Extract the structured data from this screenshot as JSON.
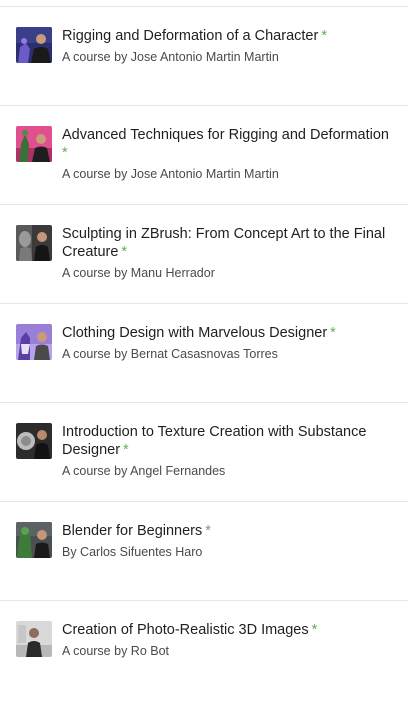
{
  "courses": [
    {
      "title": "Rigging and Deformation of a Character",
      "star": "*",
      "author": "A course by Jose Antonio Martin Martin",
      "thumbnail": "rigging-character-thumbnail"
    },
    {
      "title": "Advanced Techniques for Rigging and Deformation",
      "star": "*",
      "author": "A course by Jose Antonio Martin Martin",
      "thumbnail": "advanced-rigging-thumbnail"
    },
    {
      "title": "Sculpting in ZBrush: From Concept Art to the Final Creature",
      "star": "*",
      "author": "A course by Manu Herrador",
      "thumbnail": "zbrush-sculpting-thumbnail"
    },
    {
      "title": "Clothing Design with Marvelous Designer",
      "star": "*",
      "author": "A course by Bernat Casasnovas Torres",
      "thumbnail": "marvelous-designer-thumbnail"
    },
    {
      "title": "Introduction to Texture Creation with Substance Designer",
      "star": "*",
      "author": "A course by Angel Fernandes",
      "thumbnail": "substance-designer-thumbnail"
    },
    {
      "title": "Blender for Beginners",
      "star": "*",
      "author": "By Carlos Sifuentes Haro",
      "thumbnail": "blender-beginners-thumbnail"
    },
    {
      "title": "Creation of Photo-Realistic 3D Images",
      "star": "*",
      "author": "A course by Ro Bot",
      "thumbnail": "photorealistic-3d-thumbnail"
    }
  ],
  "colors": {
    "star": "#5fae57",
    "divider": "#e6e6e6",
    "title": "#1f1f1f",
    "author": "#4a4a4a"
  }
}
